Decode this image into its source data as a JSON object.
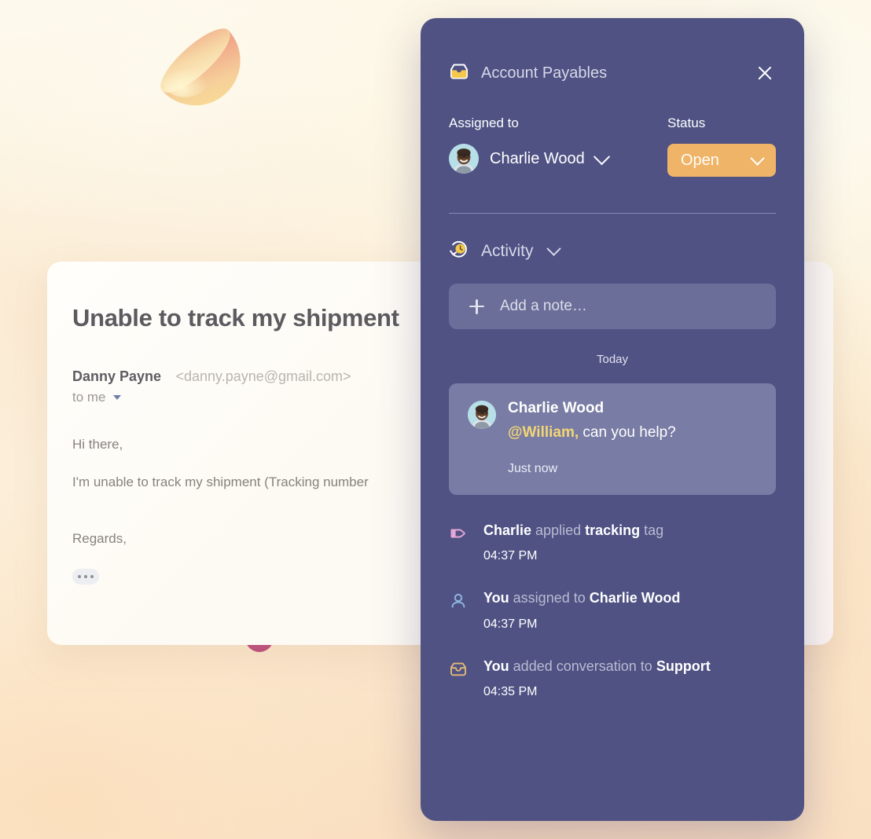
{
  "background": {
    "base_color": "#fdf8e8",
    "bottom_color": "#f8ddc0",
    "decor": {
      "sphere_name": "hemisphere-shape",
      "squiggle_name": "squiggle-shape",
      "sphere_colors": [
        "#f6d79a",
        "#f0a988",
        "#fbe9b6"
      ],
      "squiggle_colors": [
        "#c0507e",
        "#f0a06a",
        "#f7cf7f"
      ]
    }
  },
  "email_card": {
    "subject": "Unable to track my shipment",
    "sender_name": "Danny Payne",
    "sender_email": "<danny.payne@gmail.com>",
    "recipient": "to me",
    "body_greeting": "Hi there,",
    "body_line": "I'm unable to track my shipment (Tracking number",
    "body_regards": "Regards,",
    "more_label": "more-options"
  },
  "panel": {
    "title": "Account Payables",
    "title_icon": "inbox-icon",
    "close_icon": "close-icon",
    "accent_color": "#efb468",
    "background_color": "#4f5283",
    "assigned": {
      "label": "Assigned to",
      "name": "Charlie Wood",
      "avatar": "charlie-wood-avatar"
    },
    "status": {
      "label": "Status",
      "value": "Open"
    },
    "activity": {
      "title": "Activity",
      "icon": "history-clock-icon",
      "add_note_placeholder": "Add a note…",
      "day_divider": "Today",
      "note": {
        "author": "Charlie Wood",
        "mention": "@William,",
        "message": " can you help?",
        "time": "Just now",
        "mention_color": "#f2d675"
      },
      "log": [
        {
          "icon": "tag-icon",
          "icon_color": "#e6a8d8",
          "actor": "Charlie",
          "verb": " applied ",
          "object": "tracking",
          "suffix": " tag",
          "time": "04:37 PM"
        },
        {
          "icon": "person-icon",
          "icon_color": "#8fb8e0",
          "actor": "You",
          "verb": " assigned to ",
          "object": "Charlie Wood",
          "suffix": "",
          "time": "04:37 PM"
        },
        {
          "icon": "inbox-icon",
          "icon_color": "#e3b877",
          "actor": "You",
          "verb": " added conversation to ",
          "object": "Support",
          "suffix": "",
          "time": "04:35 PM"
        }
      ]
    }
  }
}
